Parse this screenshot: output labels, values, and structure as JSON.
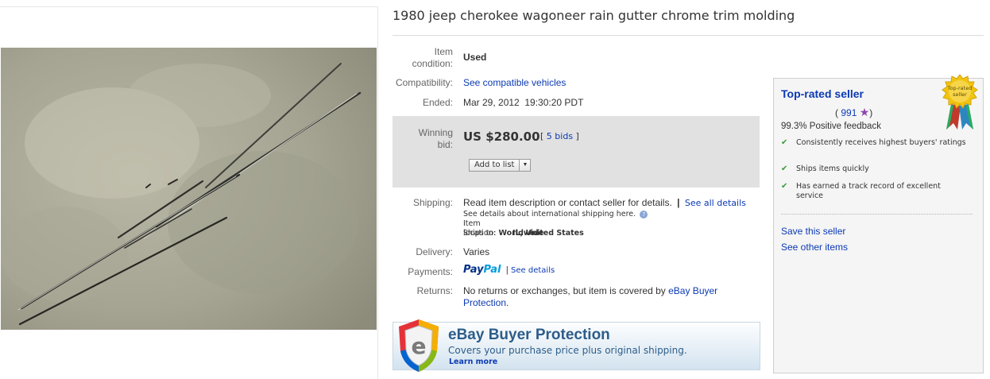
{
  "item": {
    "title": "1980 jeep cherokee wagoneer rain gutter chrome trim molding"
  },
  "details": {
    "condition_label_1": "Item",
    "condition_label_2": "condition:",
    "condition_value": "Used",
    "compatibility_label": "Compatibility:",
    "compatibility_link": "See compatible vehicles",
    "ended_label": "Ended:",
    "ended_value": "Mar 29, 2012  19:30:20 PDT"
  },
  "bid": {
    "label_1": "Winning",
    "label_2": "bid:",
    "price": "US $280.00",
    "bids_open": "[",
    "bids_link": "5 bids",
    "bids_close": "]",
    "add_to_list": "Add to list",
    "dropdown_arrow": "▼"
  },
  "shipping": {
    "label": "Shipping:",
    "text": "Read item description or contact seller for details.",
    "separator": "|",
    "see_all": "See all details",
    "intl": "See details about international shipping here.",
    "location_key": "Item location:",
    "location_value": "IL, United States",
    "ships_to_key": "Ships to:",
    "ships_to_value": "Worldwide"
  },
  "delivery": {
    "label": "Delivery:",
    "value": "Varies"
  },
  "payments": {
    "label": "Payments:",
    "paypal_1": "Pay",
    "paypal_2": "Pal",
    "separator": "|",
    "see_details": "See details"
  },
  "returns": {
    "label": "Returns:",
    "text": "No returns or exchanges, but item is covered by ",
    "link_1": "eBay Buyer",
    "link_2": "Protection",
    "end": "."
  },
  "buyer_protection": {
    "title": "eBay Buyer Protection",
    "subtitle": "Covers your purchase price plus original shipping.",
    "learn_more": "Learn more",
    "shield_letter": "e"
  },
  "seller": {
    "title": "Top-rated seller",
    "badge_text_1": "Top-rated",
    "badge_text_2": "seller",
    "feedback_open": "(",
    "feedback_count": "991",
    "feedback_close": ")",
    "feedback_pct": "99.3% Positive feedback",
    "perks": [
      "Consistently receives highest buyers' ratings",
      "Ships items quickly",
      "Has earned a track record of excellent service"
    ],
    "save_seller": "Save this seller",
    "other_items": "See other items"
  },
  "colors": {
    "link": "#0c3ab4",
    "bid_box": "#e1e1e1",
    "paypal_dark": "#003087",
    "paypal_light": "#009cde",
    "protection_text": "#2d5d8a",
    "check": "#3a9a3a"
  }
}
